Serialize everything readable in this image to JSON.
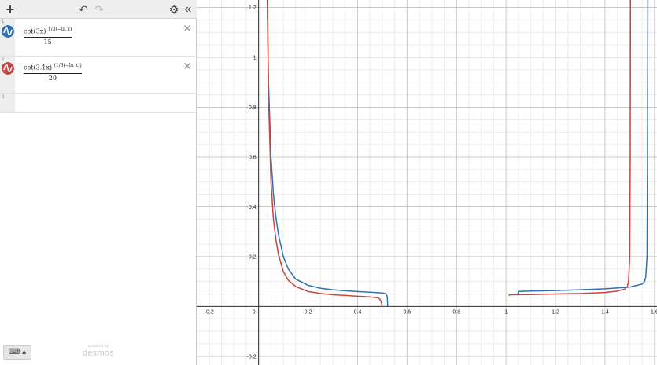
{
  "toolbar": {
    "add_icon": "plus-icon",
    "undo_icon": "undo-icon",
    "redo_icon": "redo-icon",
    "settings_icon": "gear-icon",
    "collapse_icon": "double-chevron-left-icon"
  },
  "expressions": [
    {
      "index": "1",
      "color": "#2d70b3",
      "numerator": "cot(3x)",
      "exponent": "1/3(−ln x)",
      "denominator": "15"
    },
    {
      "index": "2",
      "color": "#c74440",
      "numerator": "cot(3.1x)",
      "exponent": "(1/3(−ln x))",
      "denominator": "20"
    },
    {
      "index": "3"
    }
  ],
  "footer": {
    "keyboard_icon": "keyboard-icon",
    "powered_by": "powered by",
    "brand": "desmos"
  },
  "chart_data": {
    "type": "line",
    "x_ticks": [
      "-0.2",
      "0",
      "0.2",
      "0.4",
      "0.6",
      "0.8",
      "1",
      "1.2",
      "1.4",
      "1.6"
    ],
    "y_ticks": [
      "-0.2",
      "0.2",
      "0.4",
      "0.6",
      "0.8",
      "1",
      "1.2"
    ],
    "xlim": [
      -0.25,
      1.61
    ],
    "ylim": [
      -0.235,
      1.23
    ],
    "grid": true,
    "series": [
      {
        "color": "#2d70b3",
        "x": [
          0.035,
          0.04,
          0.05,
          0.06,
          0.07,
          0.08,
          0.1,
          0.12,
          0.15,
          0.2,
          0.25,
          0.3,
          0.35,
          0.4,
          0.45,
          0.5,
          0.51,
          0.515,
          0.52,
          0.522
        ],
        "y": [
          1.23,
          0.9,
          0.6,
          0.45,
          0.36,
          0.29,
          0.2,
          0.15,
          0.11,
          0.085,
          0.073,
          0.067,
          0.063,
          0.06,
          0.057,
          0.054,
          0.052,
          0.05,
          0.04,
          0.0
        ]
      },
      {
        "color": "#2d70b3",
        "x": [
          1.047,
          1.05,
          1.1,
          1.2,
          1.3,
          1.4,
          1.5,
          1.55,
          1.56,
          1.565,
          1.57,
          1.572,
          1.573
        ],
        "y": [
          0.045,
          0.06,
          0.062,
          0.064,
          0.067,
          0.071,
          0.078,
          0.09,
          0.1,
          0.12,
          0.2,
          0.6,
          1.23
        ]
      },
      {
        "color": "#c74440",
        "x": [
          0.036,
          0.04,
          0.05,
          0.06,
          0.07,
          0.08,
          0.1,
          0.12,
          0.15,
          0.2,
          0.25,
          0.3,
          0.35,
          0.4,
          0.45,
          0.48,
          0.49,
          0.495,
          0.5
        ],
        "y": [
          1.23,
          0.85,
          0.5,
          0.35,
          0.27,
          0.21,
          0.14,
          0.105,
          0.08,
          0.06,
          0.052,
          0.047,
          0.044,
          0.041,
          0.038,
          0.035,
          0.03,
          0.02,
          0.0
        ]
      },
      {
        "color": "#c74440",
        "x": [
          1.01,
          1.02,
          1.1,
          1.2,
          1.3,
          1.4,
          1.45,
          1.48,
          1.49,
          1.495,
          1.5,
          1.502,
          1.503
        ],
        "y": [
          0.045,
          0.047,
          0.048,
          0.05,
          0.052,
          0.056,
          0.062,
          0.07,
          0.08,
          0.1,
          0.2,
          0.6,
          1.23
        ]
      }
    ]
  }
}
